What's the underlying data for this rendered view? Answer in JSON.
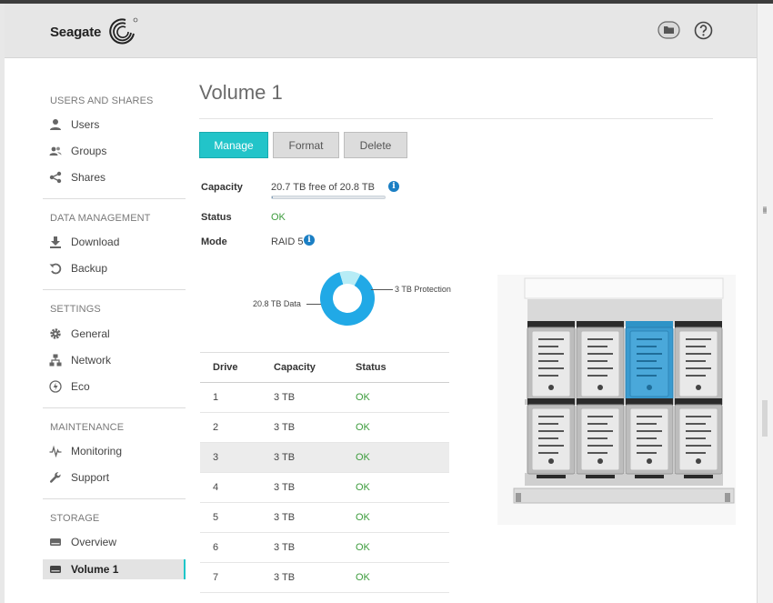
{
  "header": {
    "brand": "Seagate",
    "folder_button_icon": "folder-icon",
    "help_button_icon": "help-circle-icon"
  },
  "sidebar": {
    "sections": [
      {
        "title": "USERS AND SHARES",
        "items": [
          {
            "label": "Users",
            "icon": "user-icon"
          },
          {
            "label": "Groups",
            "icon": "group-icon"
          },
          {
            "label": "Shares",
            "icon": "share-icon"
          }
        ]
      },
      {
        "title": "DATA MANAGEMENT",
        "items": [
          {
            "label": "Download",
            "icon": "download-icon"
          },
          {
            "label": "Backup",
            "icon": "backup-icon"
          }
        ]
      },
      {
        "title": "SETTINGS",
        "items": [
          {
            "label": "General",
            "icon": "gear-icon"
          },
          {
            "label": "Network",
            "icon": "network-icon"
          },
          {
            "label": "Eco",
            "icon": "eco-icon"
          }
        ]
      },
      {
        "title": "MAINTENANCE",
        "items": [
          {
            "label": "Monitoring",
            "icon": "monitoring-icon"
          },
          {
            "label": "Support",
            "icon": "wrench-icon"
          }
        ]
      },
      {
        "title": "STORAGE",
        "items": [
          {
            "label": "Overview",
            "icon": "overview-icon"
          },
          {
            "label": "Volume 1",
            "icon": "drive-icon",
            "active": true
          }
        ]
      }
    ]
  },
  "main": {
    "title": "Volume 1",
    "buttons": {
      "manage": "Manage",
      "format": "Format",
      "delete": "Delete"
    },
    "info": {
      "capacity_label": "Capacity",
      "capacity_value": "20.7 TB free of 20.8 TB",
      "capacity_used_fraction": 0.005,
      "status_label": "Status",
      "status_value": "OK",
      "mode_label": "Mode",
      "mode_value": "RAID 5",
      "info_glyph": "i"
    },
    "chart_data": {
      "type": "pie",
      "labels": [
        "20.8 TB Data",
        "3 TB Protection"
      ],
      "values": [
        20.8,
        3
      ],
      "colors": [
        "#21a9e6",
        "#b7ecf6"
      ]
    },
    "drive_table": {
      "columns": [
        "Drive",
        "Capacity",
        "Status"
      ],
      "rows": [
        [
          "1",
          "3 TB",
          "OK"
        ],
        [
          "2",
          "3 TB",
          "OK"
        ],
        [
          "3",
          "3 TB",
          "OK"
        ],
        [
          "4",
          "3 TB",
          "OK"
        ],
        [
          "5",
          "3 TB",
          "OK"
        ],
        [
          "6",
          "3 TB",
          "OK"
        ],
        [
          "7",
          "3 TB",
          "OK"
        ]
      ],
      "highlighted_row": 2
    },
    "enclosure": {
      "selected_bay": 3,
      "bays": 8
    }
  },
  "colors": {
    "accent": "#22c4c9",
    "ok_text": "#3d9c3d",
    "info_badge": "#1b7fc4",
    "selected_drive": "#2e93c7"
  }
}
